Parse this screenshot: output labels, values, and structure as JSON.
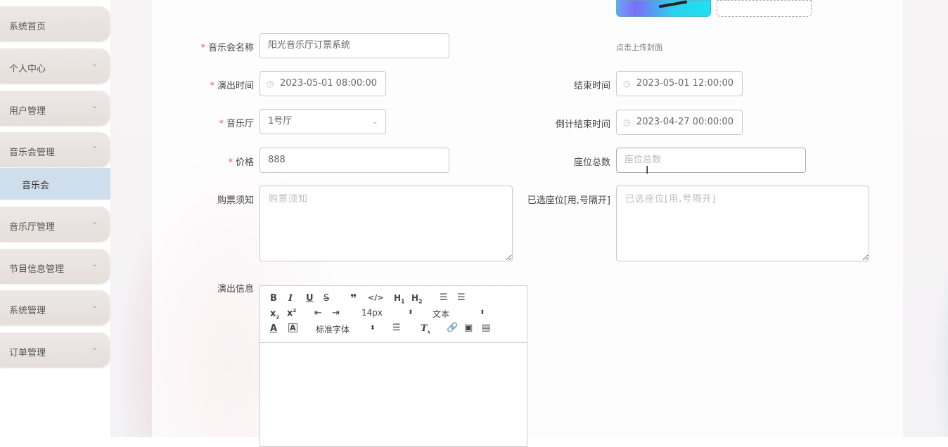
{
  "sidebar": {
    "items": [
      {
        "label": "系统首页",
        "expandable": false
      },
      {
        "label": "个人中心",
        "expandable": true,
        "expanded": false
      },
      {
        "label": "用户管理",
        "expandable": true,
        "expanded": false
      },
      {
        "label": "音乐会管理",
        "expandable": true,
        "expanded": true
      },
      {
        "label": "音乐厅管理",
        "expandable": true,
        "expanded": false
      },
      {
        "label": "节目信息管理",
        "expandable": true,
        "expanded": false
      },
      {
        "label": "系统管理",
        "expandable": true,
        "expanded": false
      },
      {
        "label": "订单管理",
        "expandable": true,
        "expanded": false
      }
    ],
    "sub_item": {
      "label": "音乐会"
    },
    "chevron_down": "⌄",
    "chevron_up": "⌃"
  },
  "form": {
    "required_mark": "*",
    "cover": {
      "upload_hint": "点击上传封面"
    },
    "name": {
      "label": "音乐会名称",
      "value": "阳光音乐厅订票系统"
    },
    "start_time": {
      "label": "演出时间",
      "value": "2023-05-01 08:00:00"
    },
    "end_time": {
      "label": "结束时间",
      "value": "2023-05-01 12:00:00"
    },
    "hall": {
      "label": "音乐厅",
      "value": "1号厅"
    },
    "countdown_end": {
      "label": "倒计结束时间",
      "value": "2023-04-27 00:00:00"
    },
    "price": {
      "label": "价格",
      "value": "888"
    },
    "total_seats": {
      "label": "座位总数",
      "placeholder": "座位总数"
    },
    "notice": {
      "label": "购票须知",
      "placeholder": "购票须知"
    },
    "selected_seats": {
      "label": "已选座位[用,号隔开]",
      "placeholder": "已选座位[用,号隔开]"
    },
    "show_info": {
      "label": "演出信息"
    }
  },
  "editor": {
    "font_size": "14px",
    "paragraph": "文本",
    "font_family": "标准字体"
  },
  "icons": {
    "clock": "◷",
    "select_caret": "⌄",
    "cursor": "I"
  }
}
